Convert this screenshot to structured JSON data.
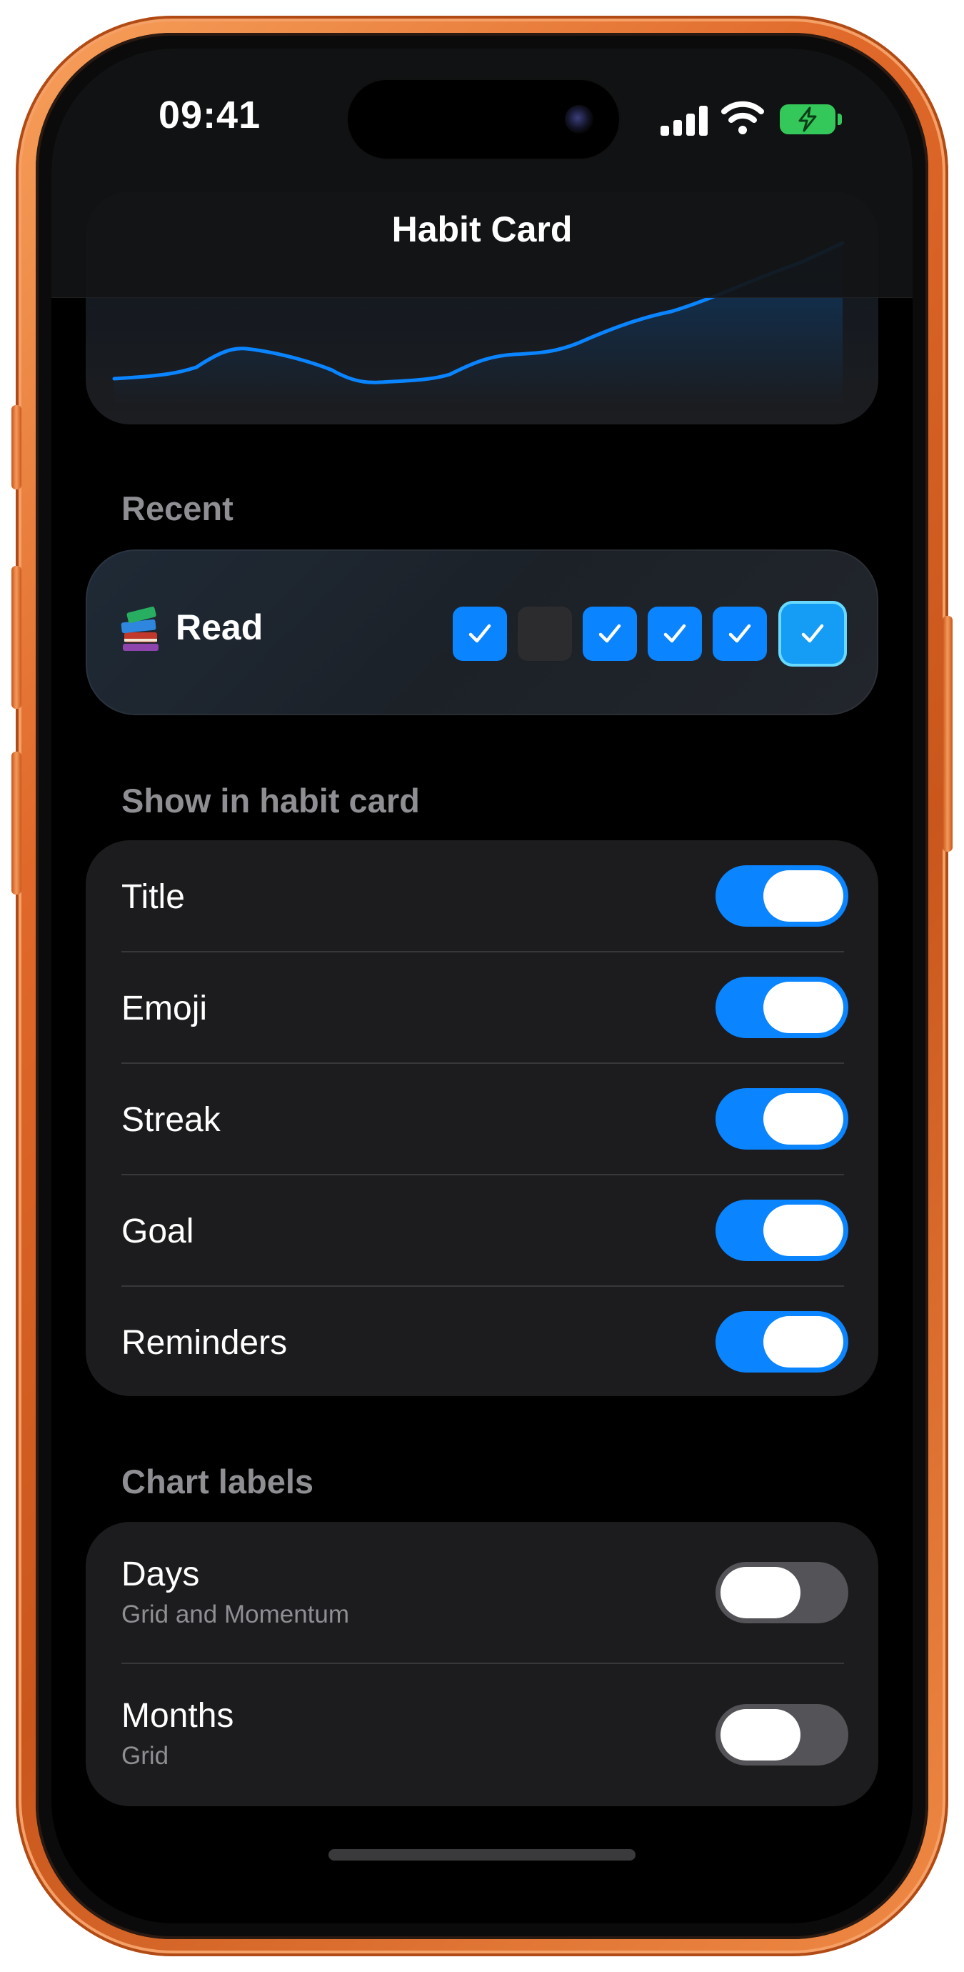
{
  "status_bar": {
    "time": "09:41",
    "signal_icon": "cellular-signal-icon",
    "wifi_icon": "wifi-icon",
    "battery_icon": "battery-charging-icon"
  },
  "nav": {
    "title": "Habit Card"
  },
  "recent": {
    "header": "Recent",
    "habit": {
      "emoji_icon": "books-icon",
      "name": "Read",
      "days_completed": [
        true,
        false,
        true,
        true,
        true,
        true
      ]
    }
  },
  "show_section": {
    "header": "Show in habit card",
    "rows": [
      {
        "label": "Title",
        "on": true
      },
      {
        "label": "Emoji",
        "on": true
      },
      {
        "label": "Streak",
        "on": true
      },
      {
        "label": "Goal",
        "on": true
      },
      {
        "label": "Reminders",
        "on": true
      }
    ]
  },
  "chart_labels_section": {
    "header": "Chart labels",
    "rows": [
      {
        "label": "Days",
        "subtitle": "Grid and Momentum",
        "on": false
      },
      {
        "label": "Months",
        "subtitle": "Grid",
        "on": false
      }
    ]
  },
  "colors": {
    "accent": "#0a84ff",
    "device_frame": "#e0692a",
    "background": "#000000",
    "card": "#1c1c1e",
    "secondary_text": "#8e8e93",
    "battery": "#34c759"
  }
}
